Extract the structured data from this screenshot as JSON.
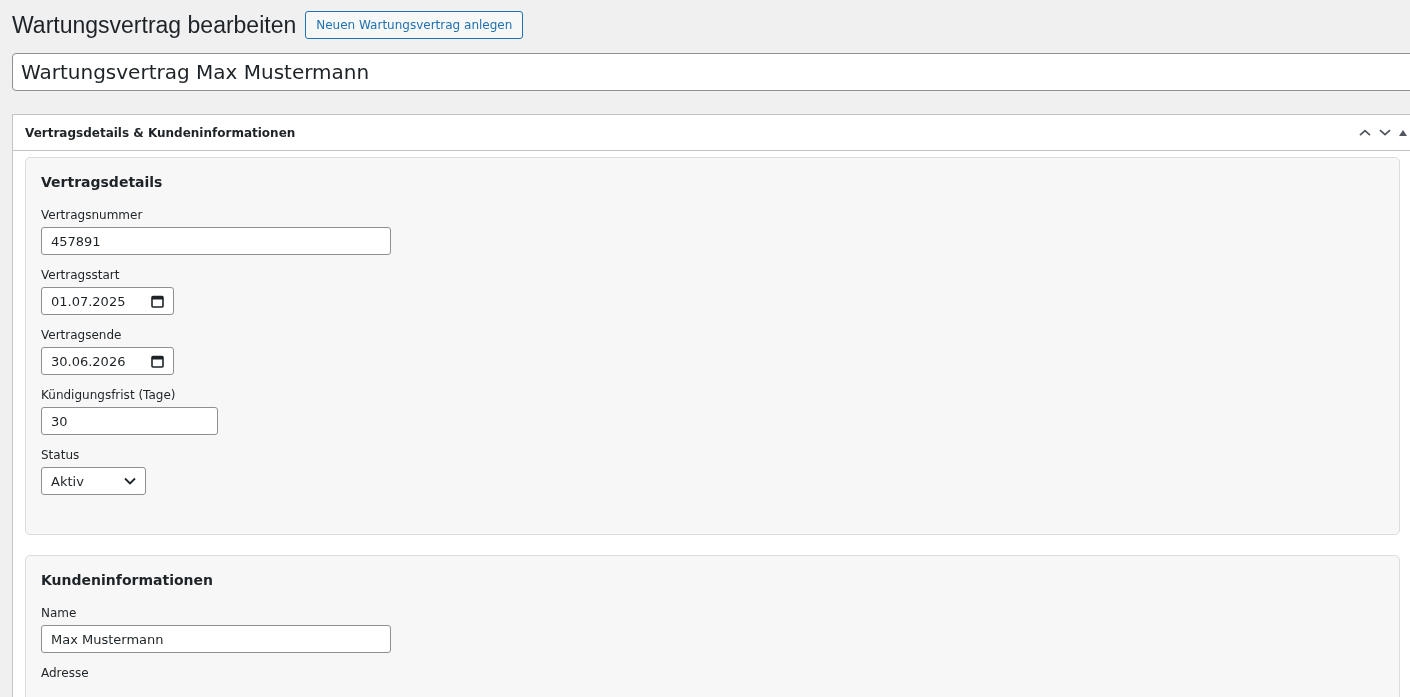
{
  "page_title": "Wartungsvertrag bearbeiten",
  "add_button": "Neuen Wartungsvertrag anlegen",
  "post_title": "Wartungsvertrag Max Mustermann",
  "metabox": {
    "title": "Vertragsdetails & Kundeninformationen",
    "expanded": true,
    "sections": [
      {
        "title": "Vertragsdetails",
        "fields": [
          {
            "kind": "text",
            "label": "Vertragsnummer",
            "value": "457891"
          },
          {
            "kind": "date",
            "label": "Vertragsstart",
            "value": "01.07.2025"
          },
          {
            "kind": "date",
            "label": "Vertragsende",
            "value": "30.06.2026"
          },
          {
            "kind": "number",
            "label": "Kündigungsfrist (Tage)",
            "value": "30"
          },
          {
            "kind": "select",
            "label": "Status",
            "value": "Aktiv"
          }
        ]
      },
      {
        "title": "Kundeninformationen",
        "fields": [
          {
            "kind": "text",
            "label": "Name",
            "value": "Max Mustermann"
          },
          {
            "kind": "label",
            "label": "Adresse"
          }
        ]
      }
    ]
  }
}
